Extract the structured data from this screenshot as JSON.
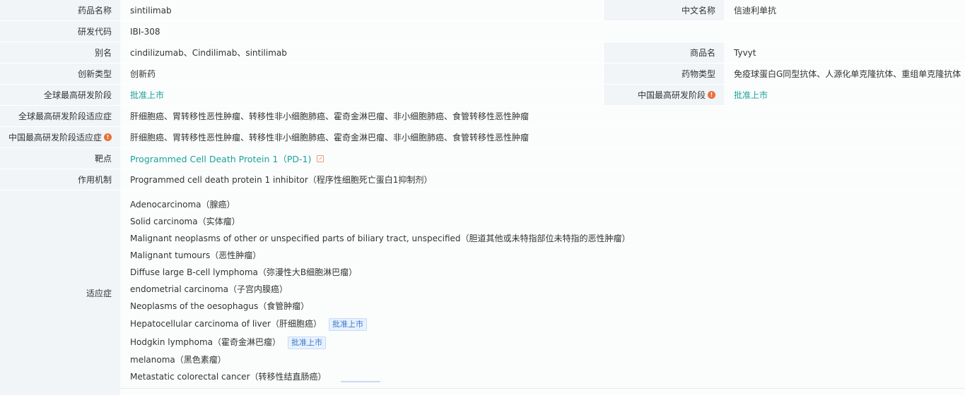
{
  "rows": {
    "drug_name": {
      "label": "药品名称",
      "value": "sintilimab"
    },
    "chinese_name": {
      "label": "中文名称",
      "value": "信迪利单抗"
    },
    "dev_code": {
      "label": "研发代码",
      "value": "IBI-308"
    },
    "alias": {
      "label": "别名",
      "value": "cindilizumab、Cindilimab、sintilimab"
    },
    "trade_name": {
      "label": "商品名",
      "value": "Tyvyt"
    },
    "innovation_type": {
      "label": "创新类型",
      "value": "创新药"
    },
    "drug_type": {
      "label": "药物类型",
      "value": "免疫球蛋白G同型抗体、人源化单克隆抗体、重组单克隆抗体"
    },
    "global_phase": {
      "label": "全球最高研发阶段",
      "value": "批准上市"
    },
    "china_phase": {
      "label": "中国最高研发阶段",
      "value": "批准上市"
    },
    "global_phase_indication": {
      "label": "全球最高研发阶段适应症",
      "value": "肝细胞癌、胃转移性恶性肿瘤、转移性非小细胞肺癌、霍奇金淋巴瘤、非小细胞肺癌、食管转移性恶性肿瘤"
    },
    "china_phase_indication": {
      "label": "中国最高研发阶段适应症",
      "value": "肝细胞癌、胃转移性恶性肿瘤、转移性非小细胞肺癌、霍奇金淋巴瘤、非小细胞肺癌、食管转移性恶性肿瘤"
    },
    "target": {
      "label": "靶点",
      "value": "Programmed Cell Death Protein 1（PD-1)"
    },
    "mechanism": {
      "label": "作用机制",
      "value": "Programmed cell death protein 1 inhibitor（程序性细胞死亡蛋白1抑制剂）"
    }
  },
  "indications": {
    "label": "适应症",
    "items": [
      {
        "text": "Adenocarcinoma（腺癌）",
        "badge": ""
      },
      {
        "text": "Solid carcinoma（实体瘤）",
        "badge": ""
      },
      {
        "text": "Malignant neoplasms of other or unspecified parts of biliary tract, unspecified（胆道其他或未特指部位未特指的恶性肿瘤）",
        "badge": ""
      },
      {
        "text": "Malignant tumours（恶性肿瘤）",
        "badge": ""
      },
      {
        "text": "Diffuse large B-cell lymphoma（弥漫性大B细胞淋巴瘤）",
        "badge": ""
      },
      {
        "text": "endometrial carcinoma（子宫内膜癌）",
        "badge": ""
      },
      {
        "text": "Neoplasms of the oesophagus（食管肿瘤）",
        "badge": ""
      },
      {
        "text": "Hepatocellular carcinoma of liver（肝细胞癌）",
        "badge": "批准上市"
      },
      {
        "text": "Hodgkin lymphoma（霍奇金淋巴瘤）",
        "badge": "批准上市"
      },
      {
        "text": "melanoma（黑色素瘤）",
        "badge": ""
      },
      {
        "text": "Metastatic colorectal cancer（转移性结直肠癌）",
        "badge": ""
      }
    ]
  },
  "colors": {
    "label_bg": "#f1f5f7",
    "value_bg": "#fbfcfc",
    "link": "#1aa39a",
    "badge_text": "#3b78c9",
    "info_icon": "#e8703a"
  },
  "icons": {
    "info": "info-icon",
    "external": "external-link-icon"
  }
}
